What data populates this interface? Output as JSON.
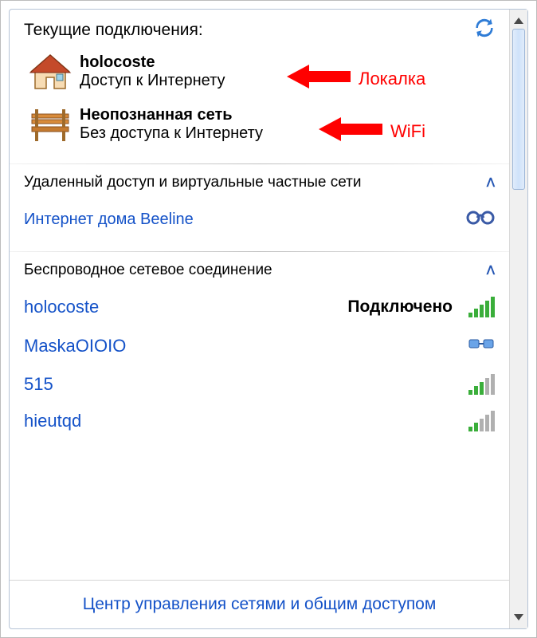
{
  "header": {
    "title": "Текущие подключения:"
  },
  "connections": [
    {
      "name": "holocoste",
      "status": "Доступ к Интернету",
      "icon": "house",
      "annotation": "Локалка"
    },
    {
      "name": "Неопознанная сеть",
      "status": "Без доступа к Интернету",
      "icon": "bench",
      "annotation": "WiFi"
    }
  ],
  "groups": {
    "vpn": {
      "title": "Удаленный доступ и виртуальные частные сети",
      "item": "Интернет дома Beeline"
    },
    "wireless": {
      "title": "Беспроводное сетевое соединение",
      "connected_label": "Подключено",
      "networks": [
        {
          "name": "holocoste",
          "bars": 5,
          "connected": true
        },
        {
          "name": "MaskaOIOIO",
          "adhoc": true
        },
        {
          "name": "515",
          "bars": 3
        },
        {
          "name": "hieutqd",
          "bars": 2
        }
      ]
    }
  },
  "footer": {
    "link": "Центр управления сетями и общим доступом"
  }
}
